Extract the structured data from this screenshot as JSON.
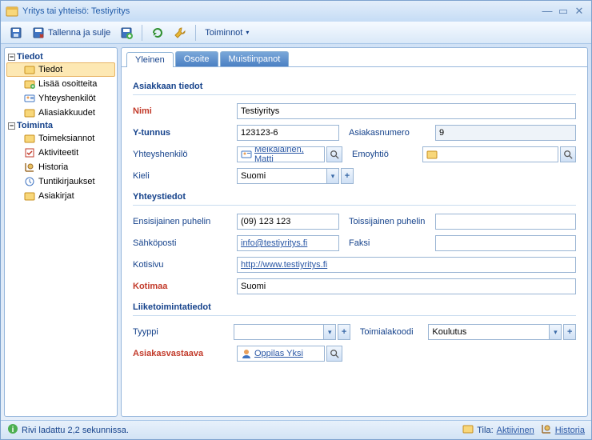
{
  "window": {
    "title": "Yritys tai yhteisö: Testiyritys"
  },
  "toolbar": {
    "save_icon": "save",
    "save_close": "Tallenna ja sulje",
    "actions_label": "Toiminnot"
  },
  "nav": {
    "groups": [
      {
        "label": "Tiedot",
        "items": [
          {
            "label": "Tiedot",
            "icon": "folder",
            "selected": true
          },
          {
            "label": "Lisää osoitteita",
            "icon": "folder-add"
          },
          {
            "label": "Yhteyshenkilöt",
            "icon": "person-card"
          },
          {
            "label": "Aliasiakkuudet",
            "icon": "folder"
          }
        ]
      },
      {
        "label": "Toiminta",
        "items": [
          {
            "label": "Toimeksiannot",
            "icon": "folder"
          },
          {
            "label": "Aktiviteetit",
            "icon": "checklist"
          },
          {
            "label": "Historia",
            "icon": "history"
          },
          {
            "label": "Tuntikirjaukset",
            "icon": "clock"
          },
          {
            "label": "Asiakirjat",
            "icon": "folder"
          }
        ]
      }
    ]
  },
  "tabs": [
    {
      "label": "Yleinen",
      "active": true
    },
    {
      "label": "Osoite",
      "active": false
    },
    {
      "label": "Muistiinpanot",
      "active": false
    }
  ],
  "sections": {
    "customer": "Asiakkaan tiedot",
    "contact": "Yhteystiedot",
    "business": "Liiketoimintatiedot"
  },
  "labels": {
    "nimi": "Nimi",
    "ytunnus": "Y-tunnus",
    "asiakasnumero": "Asiakasnumero",
    "yhteyshenkilo": "Yhteyshenkilö",
    "emoyhtio": "Emoyhtiö",
    "kieli": "Kieli",
    "ensisijainen_puh": "Ensisijainen puhelin",
    "toissijainen_puh": "Toissijainen puhelin",
    "sahkoposti": "Sähköposti",
    "faksi": "Faksi",
    "kotisivu": "Kotisivu",
    "kotimaa": "Kotimaa",
    "tyyppi": "Tyyppi",
    "toimialakoodi": "Toimialakoodi",
    "asiakasvastaava": "Asiakasvastaava"
  },
  "values": {
    "nimi": "Testiyritys",
    "ytunnus": "123123-6",
    "asiakasnumero": "9",
    "yhteyshenkilo": "Meikäläinen, Matti",
    "emoyhtio": "",
    "kieli": "Suomi",
    "ensisijainen_puh": "(09) 123 123",
    "toissijainen_puh": "",
    "sahkoposti": "info@testiyritys.fi",
    "faksi": "",
    "kotisivu": "http://www.testiyritys.fi",
    "kotimaa": "Suomi",
    "tyyppi": "",
    "toimialakoodi": "Koulutus",
    "asiakasvastaava": "Oppilas Yksi"
  },
  "status": {
    "load_msg": "Rivi ladattu 2,2 sekunnissa.",
    "state_label": "Tila:",
    "state_value": "Aktiivinen",
    "history": "Historia"
  }
}
